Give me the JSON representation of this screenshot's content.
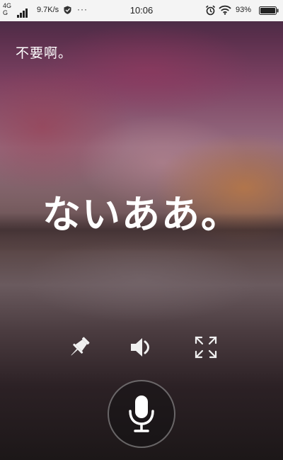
{
  "status_bar": {
    "network_top": "4G",
    "network_bottom": "G",
    "data_speed": "9.7K/s",
    "more": "···",
    "time": "10:06",
    "battery": "93%",
    "icons": [
      "signal-icon",
      "shield-icon",
      "more-icon",
      "alarm-icon",
      "wifi-icon",
      "battery-icon"
    ]
  },
  "conversation": {
    "source_text": "不要啊。",
    "translated_text": "ないああ。"
  },
  "actions": {
    "pin_icon": "pin-icon",
    "speaker_icon": "speaker-icon",
    "expand_icon": "expand-icon"
  },
  "mic": {
    "icon": "microphone-icon"
  },
  "colors": {
    "text": "#ffffff",
    "status_bar_bg": "#f4f4f4"
  }
}
